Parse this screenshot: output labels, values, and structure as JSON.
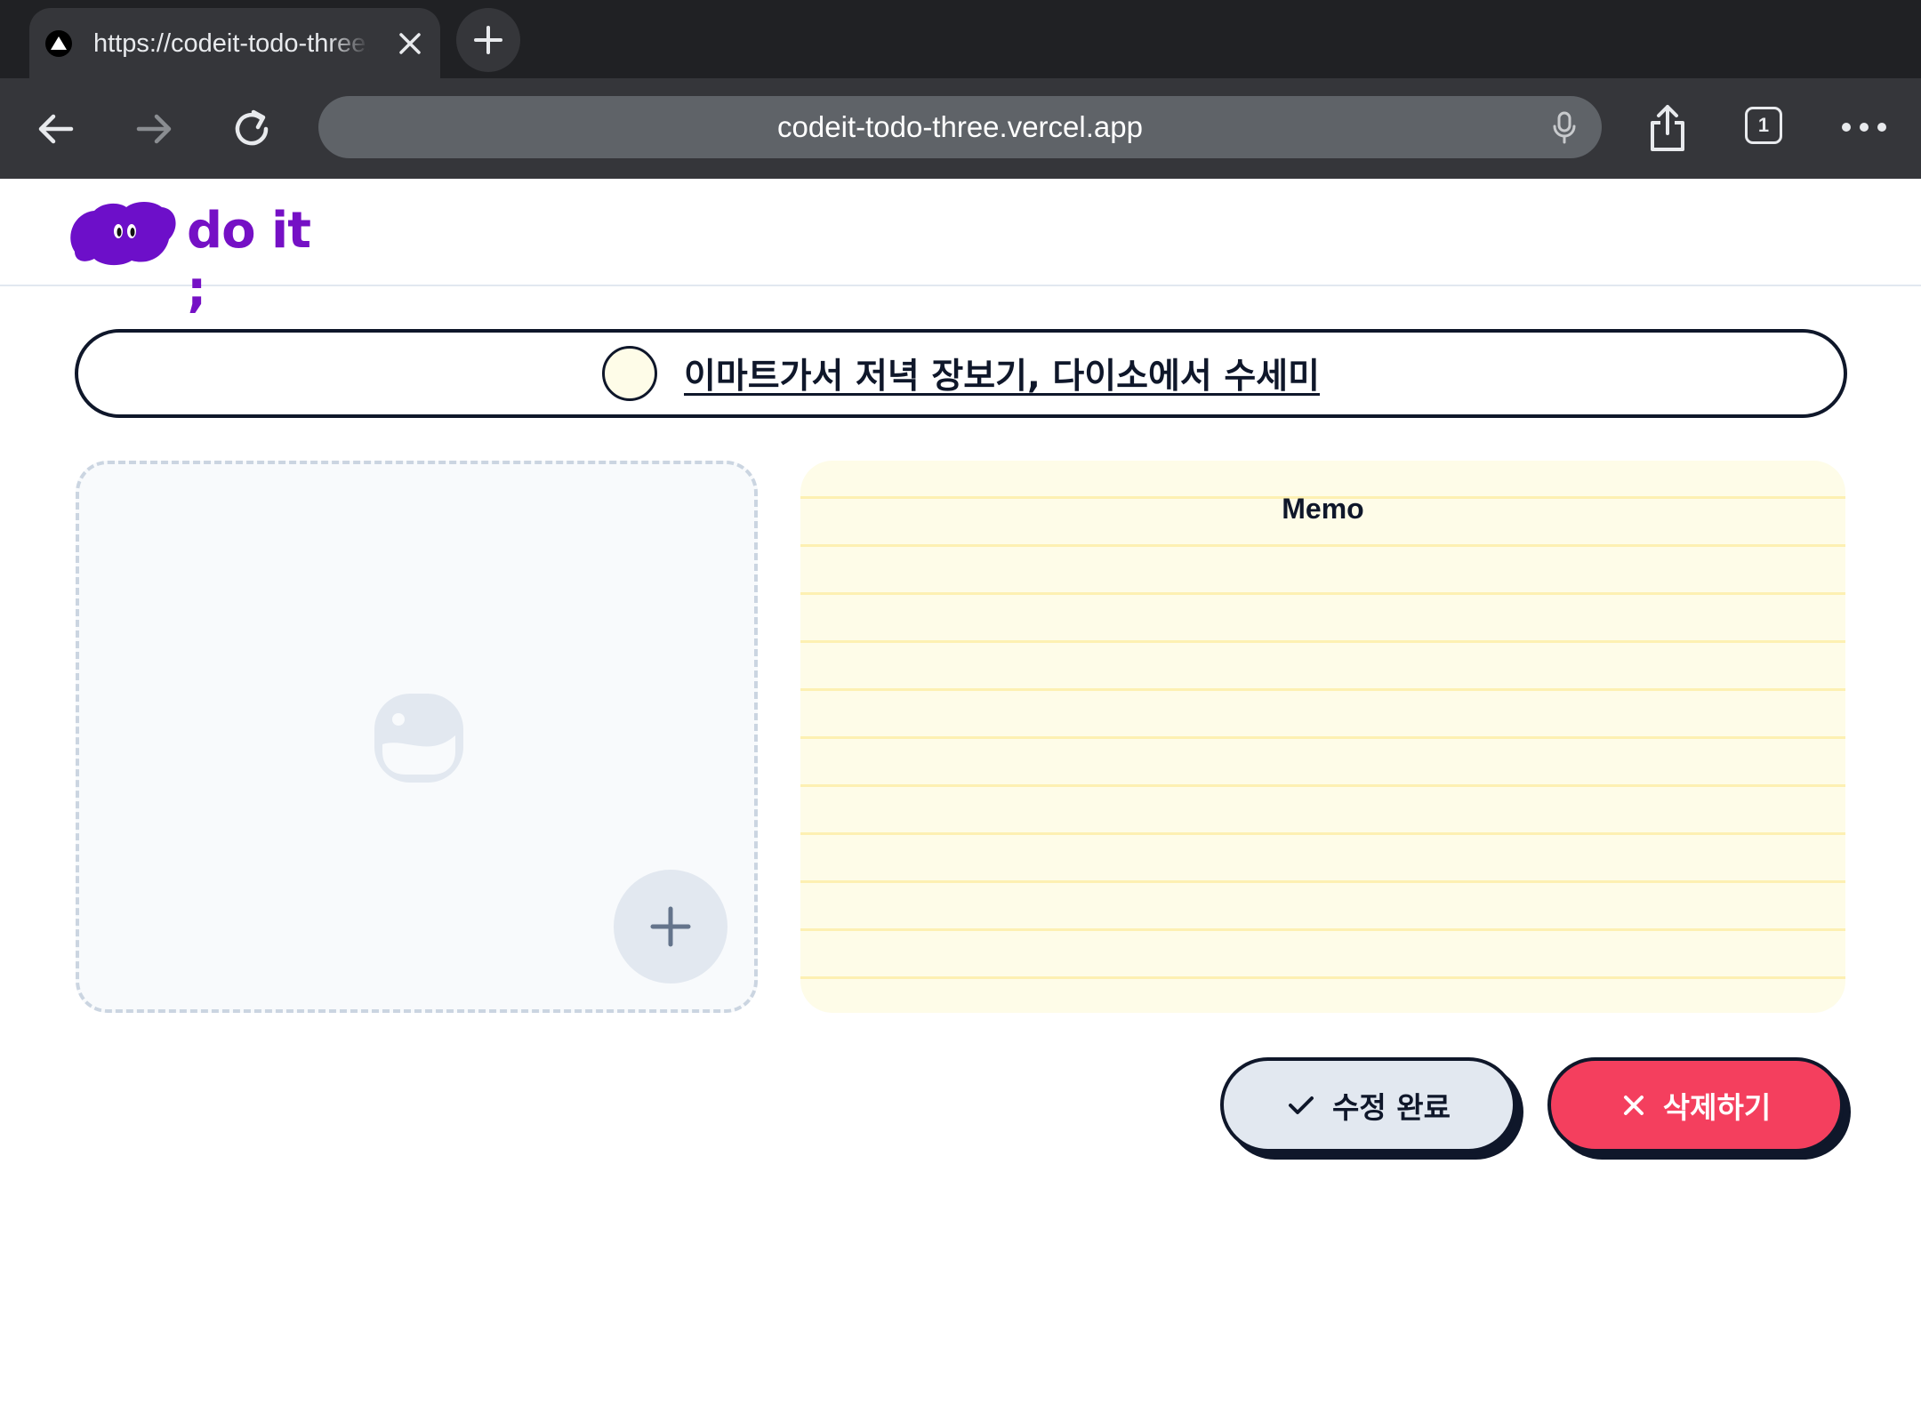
{
  "browser": {
    "tab_title": "https://codeit-todo-three.vercel.app",
    "url": "codeit-todo-three.vercel.app",
    "tab_count": "1",
    "icons": [
      "favicon-icon",
      "close-icon",
      "plus-icon",
      "back-icon",
      "forward-icon",
      "reload-icon",
      "mic-icon",
      "share-icon",
      "more-icon"
    ]
  },
  "app": {
    "logo_text": "do it ;",
    "brand_color": "#7510c5"
  },
  "todo": {
    "title": "이마트가서 저녁 장보기, 다이소에서 수세미",
    "completed": false
  },
  "image_upload": {
    "icons": [
      "image-placeholder-icon",
      "plus-icon"
    ]
  },
  "memo": {
    "label": "Memo",
    "value": ""
  },
  "actions": {
    "complete_label": "수정 완료",
    "delete_label": "삭제하기",
    "complete_color": "#e2e8f0",
    "delete_color": "#f43f5e"
  }
}
